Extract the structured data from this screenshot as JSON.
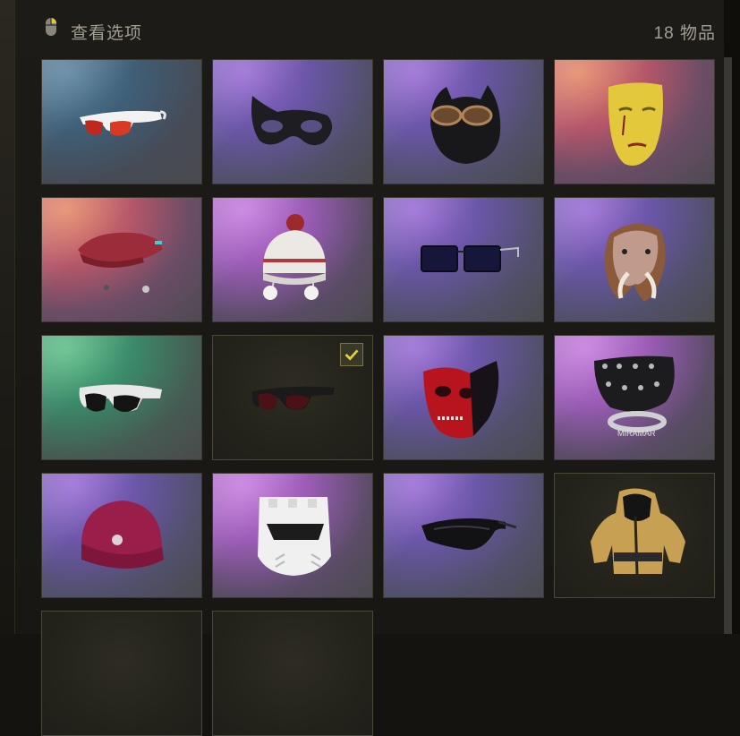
{
  "header": {
    "title": "查看选项",
    "count": "18 物品",
    "icon": "mouse-icon"
  },
  "items": [
    {
      "name": "red-sunglasses",
      "bg": "blue",
      "selected": false
    },
    {
      "name": "black-eye-mask",
      "bg": "purple",
      "selected": false
    },
    {
      "name": "cat-ear-goggles-beanie",
      "bg": "purple",
      "selected": false
    },
    {
      "name": "yellow-face-mask",
      "bg": "orange",
      "selected": false
    },
    {
      "name": "red-beret-with-earrings",
      "bg": "orange",
      "selected": false
    },
    {
      "name": "knit-pompom-hat",
      "bg": "pink",
      "selected": false
    },
    {
      "name": "blue-square-sunglasses",
      "bg": "purple",
      "selected": false
    },
    {
      "name": "mammoth-mask",
      "bg": "purple",
      "selected": false
    },
    {
      "name": "white-sport-sunglasses",
      "bg": "green",
      "selected": false
    },
    {
      "name": "dark-red-sunglasses",
      "bg": "dark",
      "selected": true
    },
    {
      "name": "red-skull-half-mask",
      "bg": "purple",
      "selected": false
    },
    {
      "name": "spiked-mask-miramar",
      "bg": "pink",
      "selected": false
    },
    {
      "name": "magenta-beanie",
      "bg": "purple",
      "selected": false
    },
    {
      "name": "white-armor-helmet",
      "bg": "pink",
      "selected": false
    },
    {
      "name": "black-visor-glasses",
      "bg": "purple",
      "selected": false
    },
    {
      "name": "hooded-jacket",
      "bg": "dark",
      "selected": false
    },
    {
      "name": "item-17",
      "bg": "dark",
      "selected": false
    },
    {
      "name": "item-18",
      "bg": "dark",
      "selected": false
    }
  ],
  "labels": {
    "miramar_text": "MIRAMAR"
  }
}
